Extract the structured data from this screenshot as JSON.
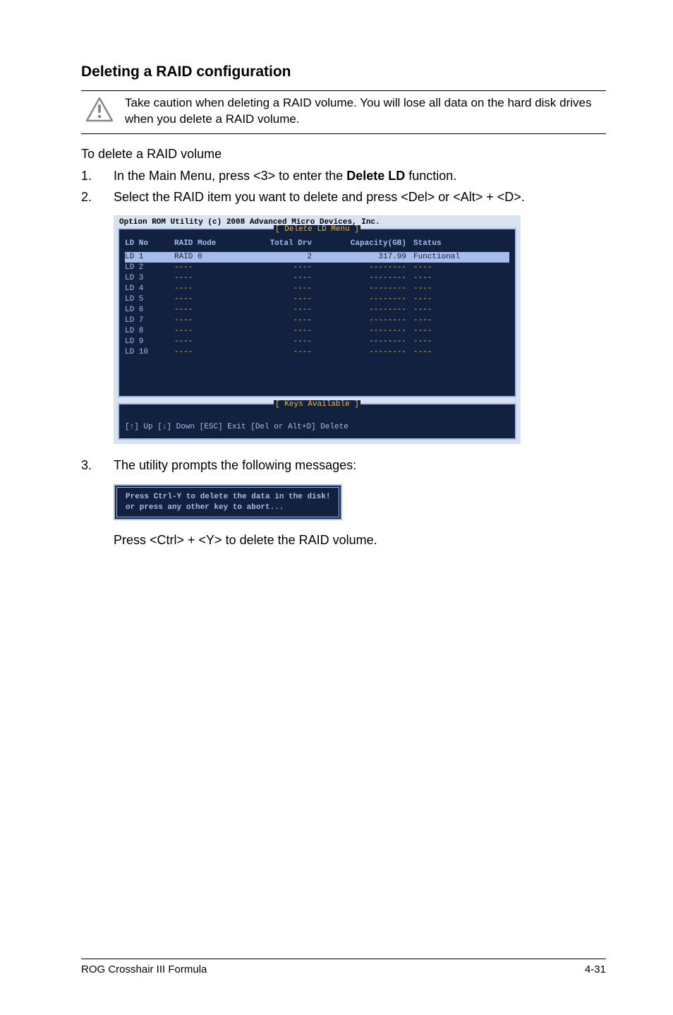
{
  "heading": "Deleting a RAID configuration",
  "caution": "Take caution when deleting a RAID volume. You will lose all data on the hard disk drives when you delete a RAID volume.",
  "intro": "To delete a RAID volume",
  "steps": {
    "s1_prefix": "In the Main Menu, press <3> to enter the ",
    "s1_bold": "Delete LD",
    "s1_suffix": " function.",
    "s2": "Select the RAID item you want to delete and press <Del> or <Alt> + <D>.",
    "s3": "The utility prompts the following messages:"
  },
  "bios": {
    "top_line": "Option ROM Utility (c) 2008 Advanced Micro Devices, Inc.",
    "menu_title": "[ Delete LD Menu ]",
    "headers": {
      "ld": "LD No",
      "raid": "RAID Mode",
      "drv": "Total Drv",
      "cap": "Capacity(GB)",
      "stat": "Status"
    },
    "rows": [
      {
        "ld": "LD  1",
        "raid": "RAID 0",
        "drv": "2",
        "cap": "317.99",
        "stat": "Functional",
        "selected": true
      },
      {
        "ld": "LD  2",
        "raid": "----",
        "drv": "----",
        "cap": "--------",
        "stat": "----"
      },
      {
        "ld": "LD  3",
        "raid": "----",
        "drv": "----",
        "cap": "--------",
        "stat": "----"
      },
      {
        "ld": "LD  4",
        "raid": "----",
        "drv": "----",
        "cap": "--------",
        "stat": "----"
      },
      {
        "ld": "LD  5",
        "raid": "----",
        "drv": "----",
        "cap": "--------",
        "stat": "----"
      },
      {
        "ld": "LD  6",
        "raid": "----",
        "drv": "----",
        "cap": "--------",
        "stat": "----"
      },
      {
        "ld": "LD  7",
        "raid": "----",
        "drv": "----",
        "cap": "--------",
        "stat": "----"
      },
      {
        "ld": "LD  8",
        "raid": "----",
        "drv": "----",
        "cap": "--------",
        "stat": "----"
      },
      {
        "ld": "LD  9",
        "raid": "----",
        "drv": "----",
        "cap": "--------",
        "stat": "----"
      },
      {
        "ld": "LD 10",
        "raid": "----",
        "drv": "----",
        "cap": "--------",
        "stat": "----"
      }
    ],
    "keys_title": "[ Keys Available ]",
    "keys_text": "[↑] Up [↓] Down [ESC] Exit [Del or Alt+D] Delete"
  },
  "confirm": {
    "line1": "Press Ctrl-Y to delete the data in the disk!",
    "line2": "or press any other key to abort..."
  },
  "after_confirm": "Press <Ctrl> + <Y> to delete the RAID volume.",
  "footer": {
    "left": "ROG Crosshair III Formula",
    "right": "4-31"
  }
}
